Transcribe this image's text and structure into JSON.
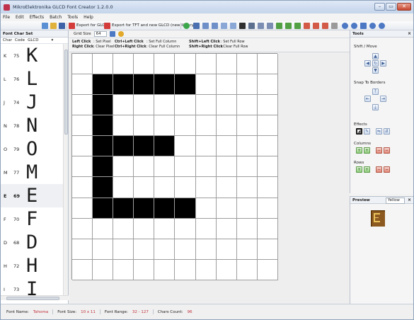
{
  "window": {
    "title": "MikroElektronika GLCD Font Creator 1.2.0.0",
    "min": "–",
    "max": "▭",
    "close": "✕"
  },
  "menu": [
    "File",
    "Edit",
    "Effects",
    "Batch",
    "Tools",
    "Help"
  ],
  "toolbar": {
    "export_glcd": "Export for GLCD",
    "export_tft": "Export for TFT and new GLCD (new library)"
  },
  "left_panel": {
    "title": "Font Char Set",
    "columns": [
      "Char",
      "Code",
      "GLCD"
    ],
    "rows": [
      {
        "char": "K",
        "code": "75",
        "selected": false
      },
      {
        "char": "L",
        "code": "76",
        "selected": false
      },
      {
        "char": "J",
        "code": "74",
        "selected": false
      },
      {
        "char": "N",
        "code": "78",
        "selected": false
      },
      {
        "char": "O",
        "code": "79",
        "selected": false
      },
      {
        "char": "M",
        "code": "77",
        "selected": false
      },
      {
        "char": "E",
        "code": "69",
        "selected": true
      },
      {
        "char": "F",
        "code": "70",
        "selected": false
      },
      {
        "char": "D",
        "code": "68",
        "selected": false
      },
      {
        "char": "H",
        "code": "72",
        "selected": false
      },
      {
        "char": "I",
        "code": "73",
        "selected": false
      }
    ]
  },
  "editor": {
    "grid_size_label": "Grid Size",
    "grid_size_value": "64",
    "legend": {
      "left_click": "Left Click",
      "set_pixel": ": Set Pixel",
      "right_click": "Right Click",
      "clear_pixel": ": Clear Pixel",
      "ctrl_left": "Ctrl+Left Click",
      "set_col": ": Set Full Column",
      "ctrl_right": "Ctrl+Right Click",
      "clear_col": ": Clear Full Column",
      "shift_left": "Shift+Left Click",
      "set_row": ": Set Full Row",
      "shift_right": "Shift+Right Click",
      "clear_row": ": Clear Full Row"
    },
    "pixels": [
      "0000000000",
      "0111110000",
      "0100000000",
      "0100000000",
      "0111100000",
      "0100000000",
      "0100000000",
      "0111110000",
      "0000000000",
      "0000000000",
      "0000000000"
    ]
  },
  "tools": {
    "title": "Tools",
    "shift_move": "Shift / Move",
    "snap_to_borders": "Snap To Borders",
    "effects": "Effects",
    "columns": "Columns",
    "rows": "Rows"
  },
  "preview": {
    "title": "Preview",
    "color": "Yellow"
  },
  "status": {
    "font_name_label": "Font Name:",
    "font_name": "Tahoma",
    "font_size_label": "Font Size:",
    "font_size": "10 x 11",
    "font_range_label": "Font Range:",
    "font_range": "32 - 127",
    "chars_count_label": "Chars Count:",
    "chars_count": "96"
  },
  "colors": {
    "accent": "#c0303a",
    "grid_on": "#000000",
    "preview_on": "#e9c25b",
    "preview_bg": "#7a4a12"
  }
}
